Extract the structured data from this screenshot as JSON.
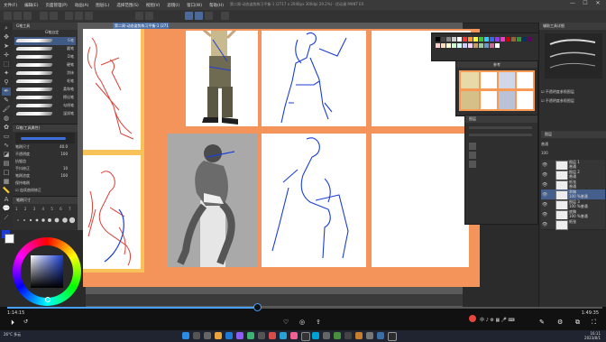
{
  "window": {
    "title": "第二周-动态姿势练习平衡-1 (2717 x 2046px 300dpi 29.2%) - 优动漫 PAINT EX",
    "menu": [
      "文件(F)",
      "编辑(E)",
      "页面管理(P)",
      "动画(A)",
      "图层(L)",
      "选择范围(S)",
      "视图(V)",
      "滤镜(I)",
      "窗口(W)",
      "帮助(H)"
    ],
    "controls": [
      "—",
      "☐",
      "✕"
    ]
  },
  "doc_tab": "第二周-动态姿势练习平衡-1 (2717 x 2046...",
  "subtool": {
    "tabs": [
      "G笔工具",
      "G笔自定"
    ],
    "brushes": [
      "G笔",
      "圆笔",
      "D笔",
      "硬笔",
      "涂抹",
      "毛笔",
      "柔和笔",
      "擦出笔",
      "勾线笔",
      "湿润笔"
    ],
    "selected_index": 0
  },
  "tool_property": {
    "title": "G笔(工具属性)",
    "rows": [
      {
        "label": "笔刷尺寸",
        "value": "40.0"
      },
      {
        "label": "不透明度",
        "value": "100"
      },
      {
        "label": "抗锯齿",
        "value": ""
      },
      {
        "label": "手抖修正",
        "value": "10"
      },
      {
        "label": "笔刷浓度",
        "value": "100"
      },
      {
        "label": "保持笔刷",
        "value": ""
      }
    ],
    "checkbox_label": "连续曲线修正"
  },
  "brush_size_panel": {
    "title": "笔刷尺寸",
    "sizes": [
      "1",
      "2",
      "3",
      "4",
      "5",
      "6",
      "7",
      "8",
      "9",
      "10"
    ]
  },
  "color": {
    "main": "#1b3fd6",
    "sub": "#ffffff"
  },
  "reference_window": {
    "title": "参考"
  },
  "layer_float": {
    "label": "图层"
  },
  "right_panels": {
    "material_title": "辅助工具详细",
    "options": [
      "不透明度参照图层",
      "不透明度参照图层"
    ],
    "layer_panel_title": "图层",
    "blend_mode": "普通",
    "opacity": "100",
    "layers": [
      {
        "name": "图层 1",
        "sub": "普通"
      },
      {
        "name": "图层 2",
        "sub": "普通"
      },
      {
        "name": "纸张",
        "sub": "普通"
      },
      {
        "name": "草稿",
        "sub": "100 %普通"
      },
      {
        "name": "图层 3",
        "sub": "100 %普通"
      },
      {
        "name": "底稿",
        "sub": "100 %普通"
      },
      {
        "name": "纸张",
        "sub": ""
      }
    ]
  },
  "player": {
    "current_time": "1:14:15",
    "total_time": "1:49:35",
    "progress": 0.42,
    "buttons": [
      "play",
      "rewind",
      "volume",
      "subtitles",
      "settings",
      "fullscreen"
    ]
  },
  "taskbar": {
    "weather_temp": "26°C",
    "weather_text": "多云",
    "time": "16:11",
    "date": "2023/8/1"
  }
}
